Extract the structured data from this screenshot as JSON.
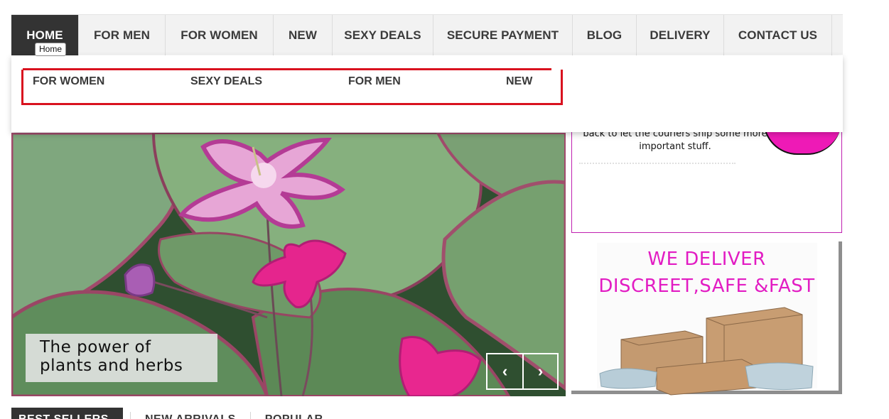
{
  "nav": {
    "items": [
      {
        "label": "HOME",
        "active": true
      },
      {
        "label": "FOR MEN"
      },
      {
        "label": "FOR WOMEN"
      },
      {
        "label": "NEW"
      },
      {
        "label": "SEXY DEALS"
      },
      {
        "label": "SECURE PAYMENT"
      },
      {
        "label": "BLOG"
      },
      {
        "label": "DELIVERY"
      },
      {
        "label": "CONTACT US"
      }
    ],
    "tooltip": "Home"
  },
  "dropdown": {
    "items": [
      "FOR WOMEN",
      "SEXY DEALS",
      "FOR MEN",
      "NEW"
    ],
    "highlight_color": "#d9121f"
  },
  "slider": {
    "caption_line1": "The power of",
    "caption_line2": "plants and herbs",
    "prev_icon": "chevron-left-icon",
    "next_icon": "chevron-right-icon",
    "prev_glyph": "‹",
    "next_glyph": "›"
  },
  "promo_top": {
    "text_line1": "back to let the couriers ship some more",
    "text_line2": "important stuff.",
    "accent_color": "#ee1ab6"
  },
  "promo_delivery": {
    "line1": "WE DELIVER",
    "line2": "DISCREET,SAFE &FAST",
    "color": "#e21cc3"
  },
  "tabs": {
    "items": [
      "BEST SELLERS",
      "NEW ARRIVALS",
      "POPULAR"
    ]
  },
  "colors": {
    "nav_bg": "#f2f2f2",
    "nav_active": "#333333",
    "text": "#3a3a3a"
  }
}
